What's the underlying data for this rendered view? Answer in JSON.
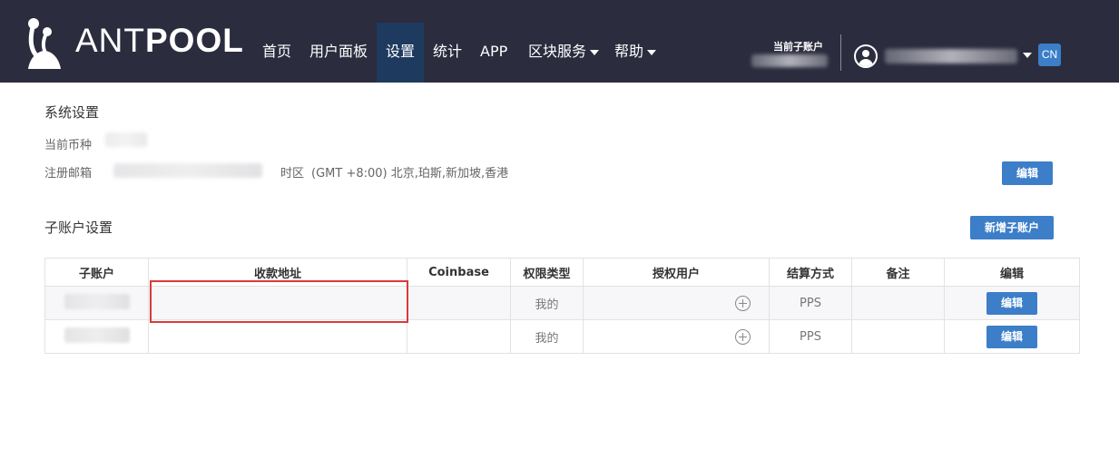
{
  "header": {
    "logo": {
      "ant": "ANT",
      "pool": "POOL"
    },
    "nav": [
      {
        "label": "首页"
      },
      {
        "label": "用户面板"
      },
      {
        "label": "设置"
      },
      {
        "label": "统计"
      },
      {
        "label": "APP"
      },
      {
        "label": "区块服务"
      },
      {
        "label": "帮助"
      }
    ],
    "current_subaccount_label": "当前子账户",
    "language": "CN"
  },
  "system_settings": {
    "title": "系统设置",
    "currency_label": "当前币种",
    "email_label": "注册邮箱",
    "timezone_label": "时区",
    "timezone_value": "(GMT +8:00) 北京,珀斯,新加坡,香港",
    "edit_label": "编辑"
  },
  "subaccount_settings": {
    "title": "子账户设置",
    "add_label": "新增子账户",
    "columns": [
      "子账户",
      "收款地址",
      "Coinbase",
      "权限类型",
      "授权用户",
      "结算方式",
      "备注",
      "编辑"
    ],
    "rows": [
      {
        "permission": "我的",
        "settlement": "PPS",
        "edit": "编辑"
      },
      {
        "permission": "我的",
        "settlement": "PPS",
        "edit": "编辑"
      }
    ]
  },
  "colors": {
    "header_bg": "#2b2c3e",
    "nav_active_bg": "#1e3a5f",
    "accent": "#3c7ec8",
    "highlight": "#d93a3a"
  }
}
